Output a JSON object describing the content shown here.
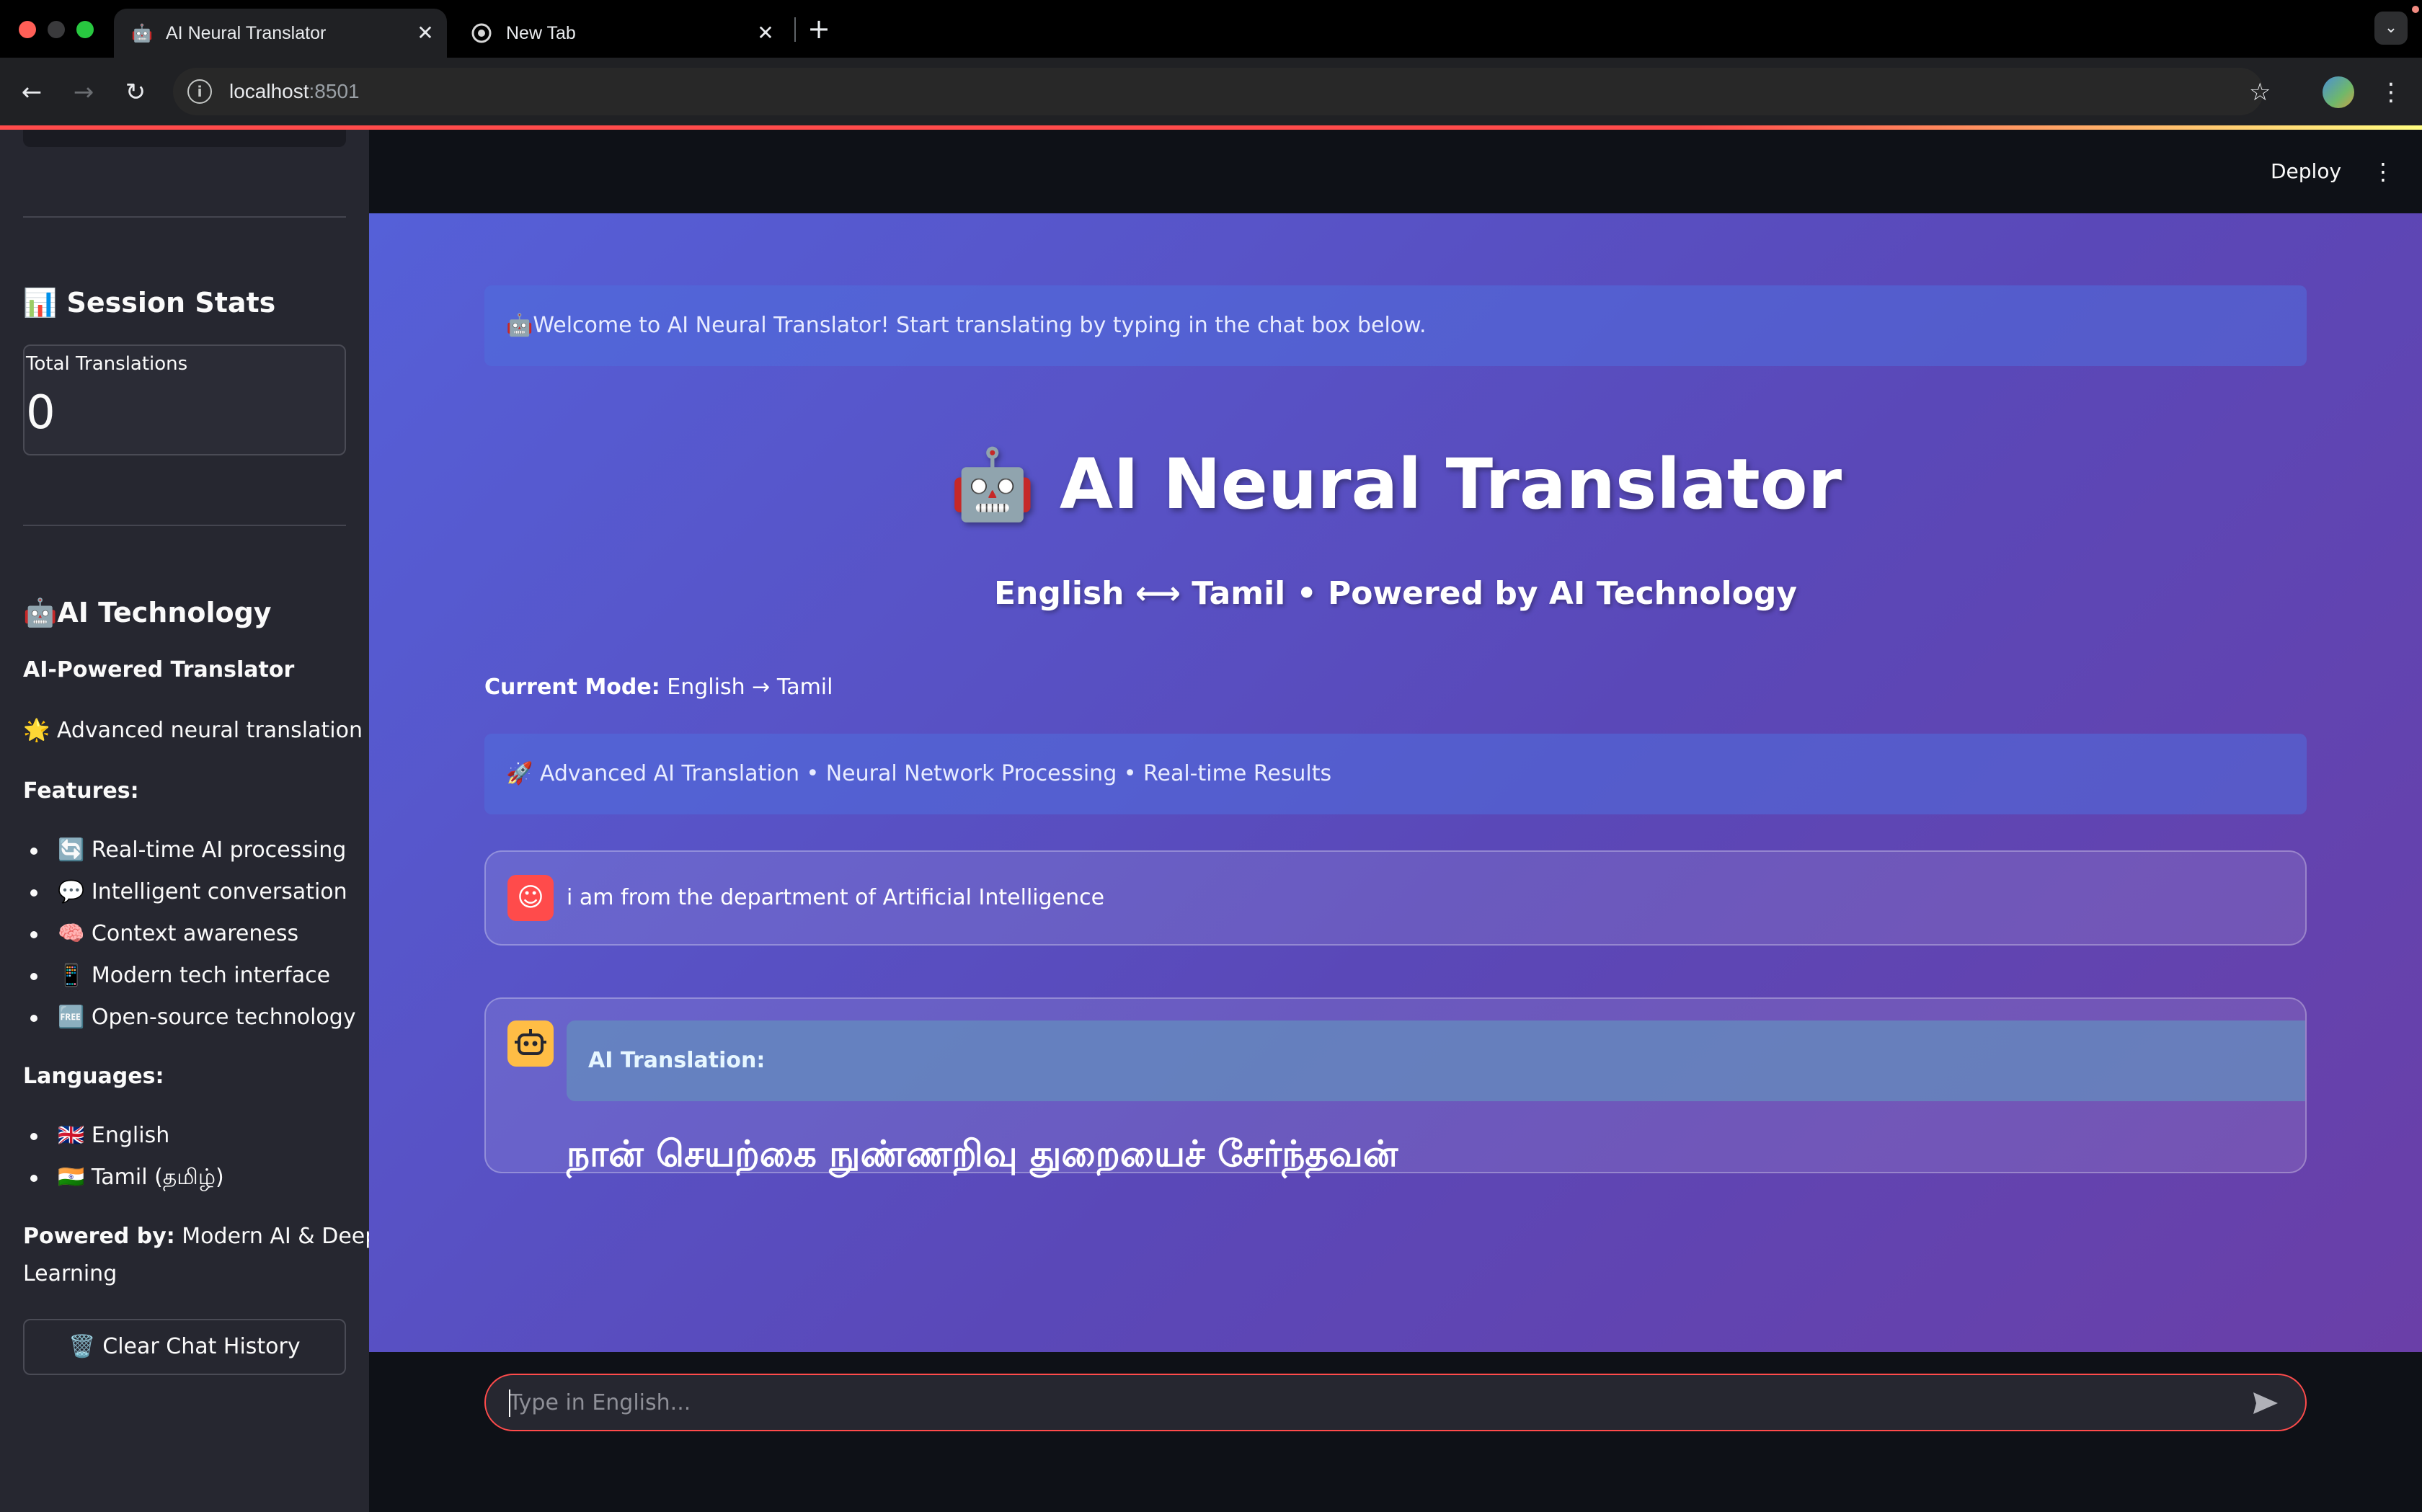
{
  "browser": {
    "tabs": [
      {
        "title": "AI Neural Translator",
        "favicon": "🤖",
        "active": true
      },
      {
        "title": "New Tab",
        "favicon": "chrome-icon",
        "active": false
      }
    ],
    "url": {
      "host": "localhost",
      "port": ":8501"
    }
  },
  "header": {
    "deploy_label": "Deploy"
  },
  "sidebar": {
    "session_stats_heading": "📊 Session Stats",
    "metric": {
      "label": "Total Translations",
      "value": "0"
    },
    "tech_heading": "🤖AI Technology",
    "subtitle": "AI-Powered Translator",
    "tagline": "🌟 Advanced neural translation",
    "features_heading": "Features:",
    "features": [
      "🔄 Real-time AI processing",
      "💬 Intelligent conversation",
      "🧠 Context awareness",
      "📱 Modern tech interface",
      "🆓 Open-source technology"
    ],
    "languages_heading": "Languages:",
    "languages": [
      "🇬🇧 English",
      "🇮🇳 Tamil (தமிழ்)"
    ],
    "powered_label": "Powered by:",
    "powered_line1": "Modern AI & Deep",
    "powered_line2": "Learning",
    "clear_button": "🗑️ Clear Chat History"
  },
  "main": {
    "welcome": "🤖Welcome to AI Neural Translator! Start translating by typing in the chat box below.",
    "title": "🤖 AI Neural Translator",
    "subtitle": "English ⟷ Tamil • Powered by AI Technology",
    "mode_label": "Current Mode:",
    "mode_value": "English → Tamil",
    "info": "🚀 Advanced AI Translation • Neural Network Processing • Real-time Results",
    "messages": {
      "user": {
        "avatar": "☺",
        "text": "i am from the department of Artificial Intelligence"
      },
      "bot": {
        "label": "AI Translation:",
        "text": "நான் செயற்கை நுண்ணறிவு துறையைச் சேர்ந்தவன்"
      }
    },
    "chat_input": {
      "placeholder": "Type in English...",
      "value": ""
    }
  },
  "colors": {
    "accent": "#ff4b4b",
    "sidebar_bg": "#262730",
    "app_bg": "#0e1117",
    "gradient_start": "#5560d8",
    "gradient_end": "#6a3fa8",
    "bot_avatar": "#ffbd45"
  }
}
